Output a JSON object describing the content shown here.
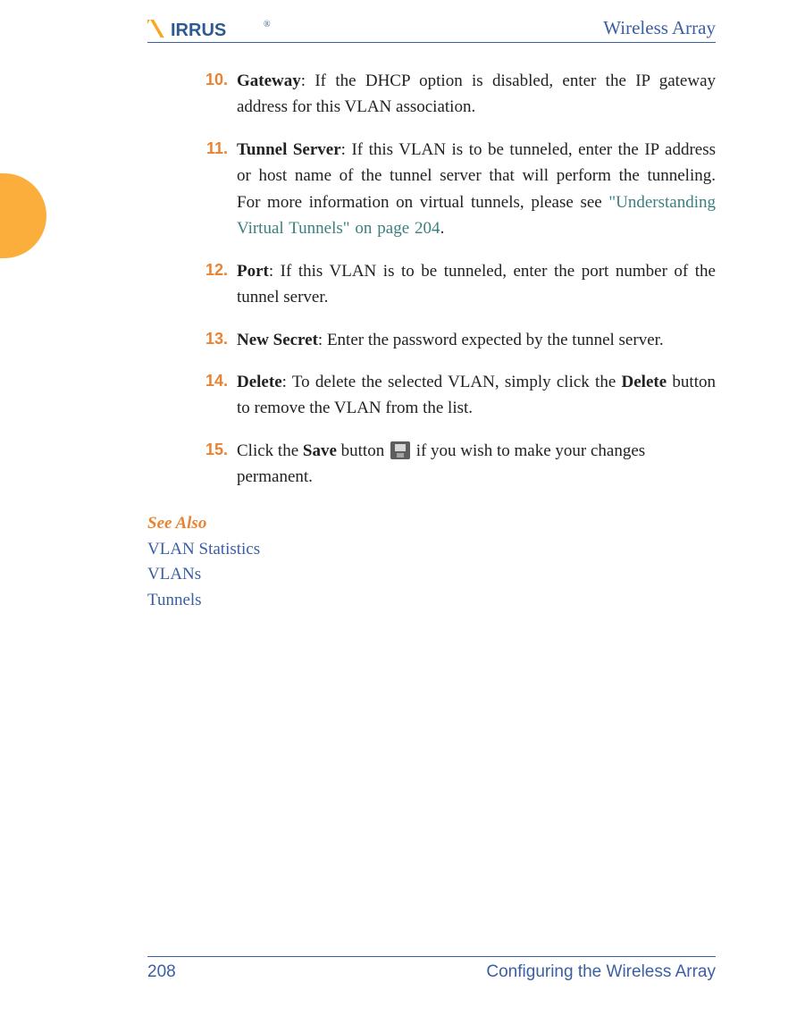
{
  "header": {
    "logo_text": "XIRRUS",
    "doc_title": "Wireless Array"
  },
  "items": [
    {
      "num": "10.",
      "title": "Gateway",
      "text": ": If the DHCP option is disabled, enter the IP gateway address for this VLAN association."
    },
    {
      "num": "11.",
      "title": "Tunnel Server",
      "text_before_link": ": If this VLAN is to be tunneled, enter the IP address or host name of the tunnel server that will perform the tunneling. For more information on virtual tunnels, please see ",
      "link_text": "\"Understanding Virtual Tunnels\" on page 204",
      "text_after_link": "."
    },
    {
      "num": "12.",
      "title": "Port",
      "text": ": If this VLAN is to be tunneled, enter the port number of the tunnel server."
    },
    {
      "num": "13.",
      "title": "New Secret",
      "text": ": Enter the password expected by the tunnel server."
    },
    {
      "num": "14.",
      "title": "Delete",
      "text_before_bold": ": To delete the selected VLAN, simply click the ",
      "bold_word": "Delete",
      "text_after_bold": " button to remove the VLAN from the list."
    },
    {
      "num": "15.",
      "text_before": "Click the ",
      "bold_word": "Save",
      "text_middle": " button ",
      "text_after": " if you wish to make your changes permanent."
    }
  ],
  "see_also": {
    "heading": "See Also",
    "links": [
      "VLAN Statistics",
      "VLANs",
      "Tunnels"
    ]
  },
  "footer": {
    "page": "208",
    "section": "Configuring the Wireless Array"
  }
}
